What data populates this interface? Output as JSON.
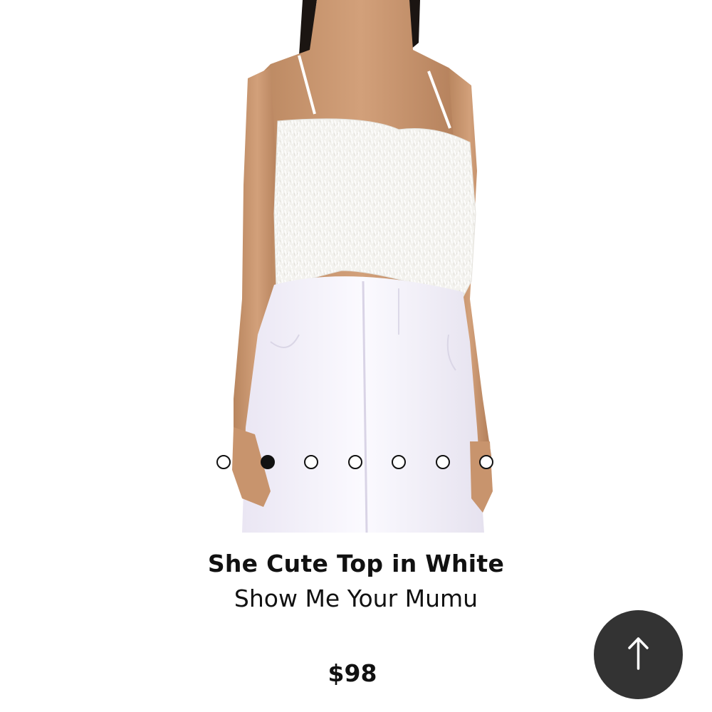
{
  "product": {
    "title": "She Cute Top in White",
    "brand": "Show Me Your Mumu",
    "price": "$98"
  },
  "carousel": {
    "total": 7,
    "active_index": 1
  },
  "scroll_top": {
    "icon": "arrow-up-icon"
  },
  "colors": {
    "text": "#111111",
    "scroll_button_bg": "#333333",
    "scroll_button_icon": "#ffffff",
    "background": "#ffffff"
  }
}
